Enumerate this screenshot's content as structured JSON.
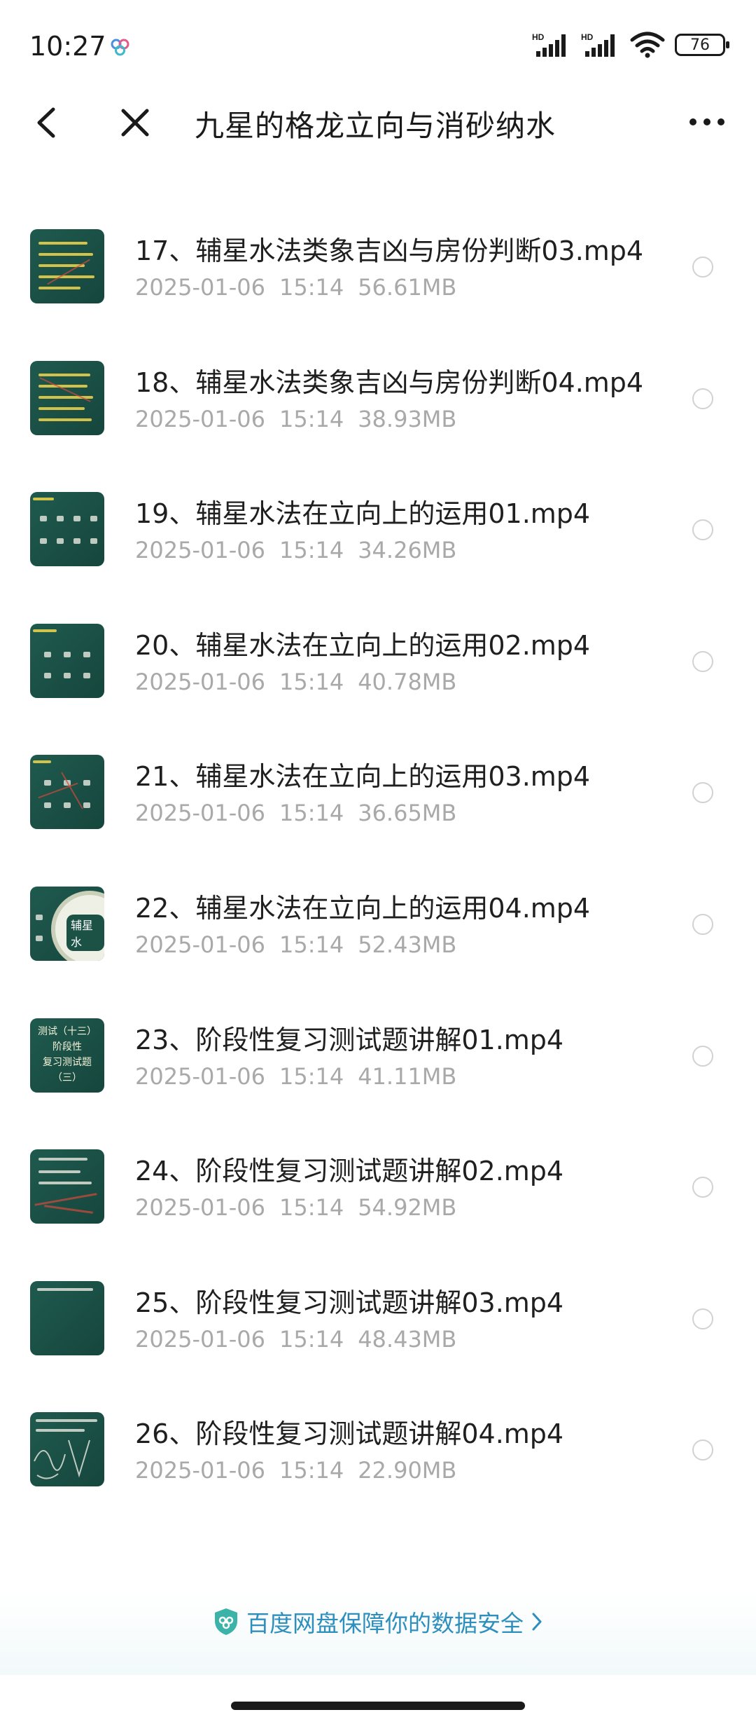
{
  "status_bar": {
    "time": "10:27",
    "sim1": "HD",
    "sim2": "HD",
    "battery": "76"
  },
  "nav": {
    "title": "九星的格龙立向与消砂纳水",
    "back_icon": "chevron-left-icon",
    "close_icon": "close-icon",
    "more_icon": "more-dots-icon"
  },
  "files": [
    {
      "name": "17、辅星水法类象吉凶与房份判断03.mp4",
      "date": "2025-01-06",
      "time": "15:14",
      "size": "56.61MB"
    },
    {
      "name": "18、辅星水法类象吉凶与房份判断04.mp4",
      "date": "2025-01-06",
      "time": "15:14",
      "size": "38.93MB"
    },
    {
      "name": "19、辅星水法在立向上的运用01.mp4",
      "date": "2025-01-06",
      "time": "15:14",
      "size": "34.26MB"
    },
    {
      "name": "20、辅星水法在立向上的运用02.mp4",
      "date": "2025-01-06",
      "time": "15:14",
      "size": "40.78MB"
    },
    {
      "name": "21、辅星水法在立向上的运用03.mp4",
      "date": "2025-01-06",
      "time": "15:14",
      "size": "36.65MB"
    },
    {
      "name": "22、辅星水法在立向上的运用04.mp4",
      "date": "2025-01-06",
      "time": "15:14",
      "size": "52.43MB"
    },
    {
      "name": "23、阶段性复习测试题讲解01.mp4",
      "date": "2025-01-06",
      "time": "15:14",
      "size": "41.11MB"
    },
    {
      "name": "24、阶段性复习测试题讲解02.mp4",
      "date": "2025-01-06",
      "time": "15:14",
      "size": "54.92MB"
    },
    {
      "name": "25、阶段性复习测试题讲解03.mp4",
      "date": "2025-01-06",
      "time": "15:14",
      "size": "48.43MB"
    },
    {
      "name": "26、阶段性复习测试题讲解04.mp4",
      "date": "2025-01-06",
      "time": "15:14",
      "size": "22.90MB"
    }
  ],
  "thumb_texts": {
    "wheel_label": "辅星水",
    "test_line1": "测试（十三）",
    "test_line2": "阶段性",
    "test_line3": "复习测试题",
    "test_line4": "（三）"
  },
  "footer": {
    "text": "百度网盘保障你的数据安全",
    "icon": "shield-icon",
    "accent": "#2e8fbd"
  }
}
